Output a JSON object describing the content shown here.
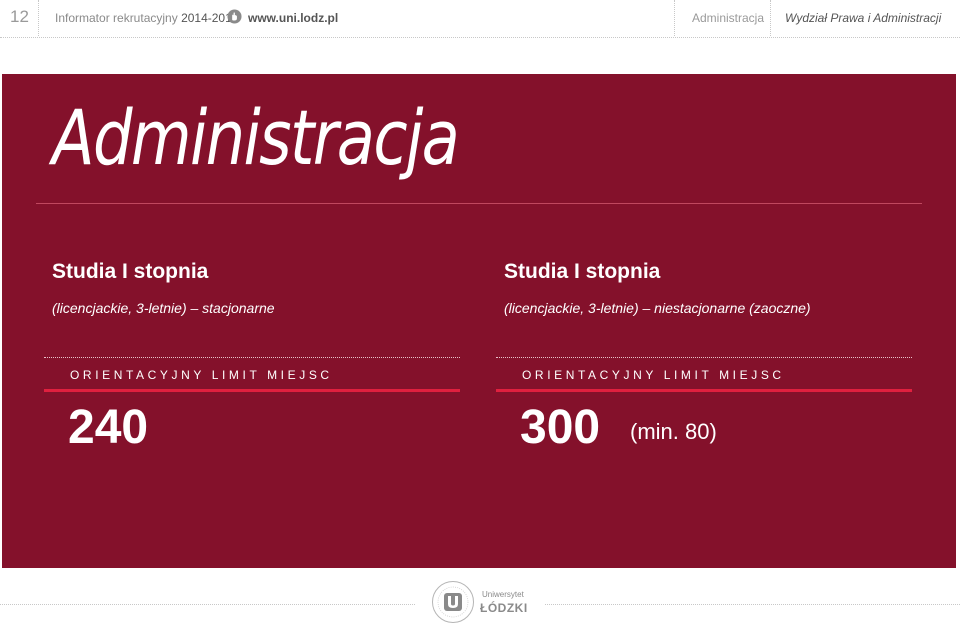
{
  "header": {
    "page_number": "12",
    "informator": "Informator rekrutacyjny",
    "year": "2014-2015",
    "url": "www.uni.lodz.pl",
    "section": "Administracja",
    "faculty": "Wydział Prawa i Administracji"
  },
  "panel": {
    "title": "Administracja",
    "background_color": "#84112b",
    "accent_color": "#e0203f",
    "columns": [
      {
        "heading": "Studia I stopnia",
        "subtitle": "(licencjackie, 3-letnie) – stacjonarne",
        "limit_label": "ORIENTACYJNY LIMIT MIEJSC",
        "limit_value": "240",
        "limit_note": ""
      },
      {
        "heading": "Studia I stopnia",
        "subtitle": "(licencjackie, 3-letnie) – niestacjonarne (zaoczne)",
        "limit_label": "ORIENTACYJNY LIMIT MIEJSC",
        "limit_value": "300",
        "limit_note": "(min. 80)"
      }
    ]
  },
  "footer": {
    "logo_line1": "Uniwersytet",
    "logo_line2": "ŁÓDZKI",
    "logo_icon": "university-seal-icon"
  }
}
